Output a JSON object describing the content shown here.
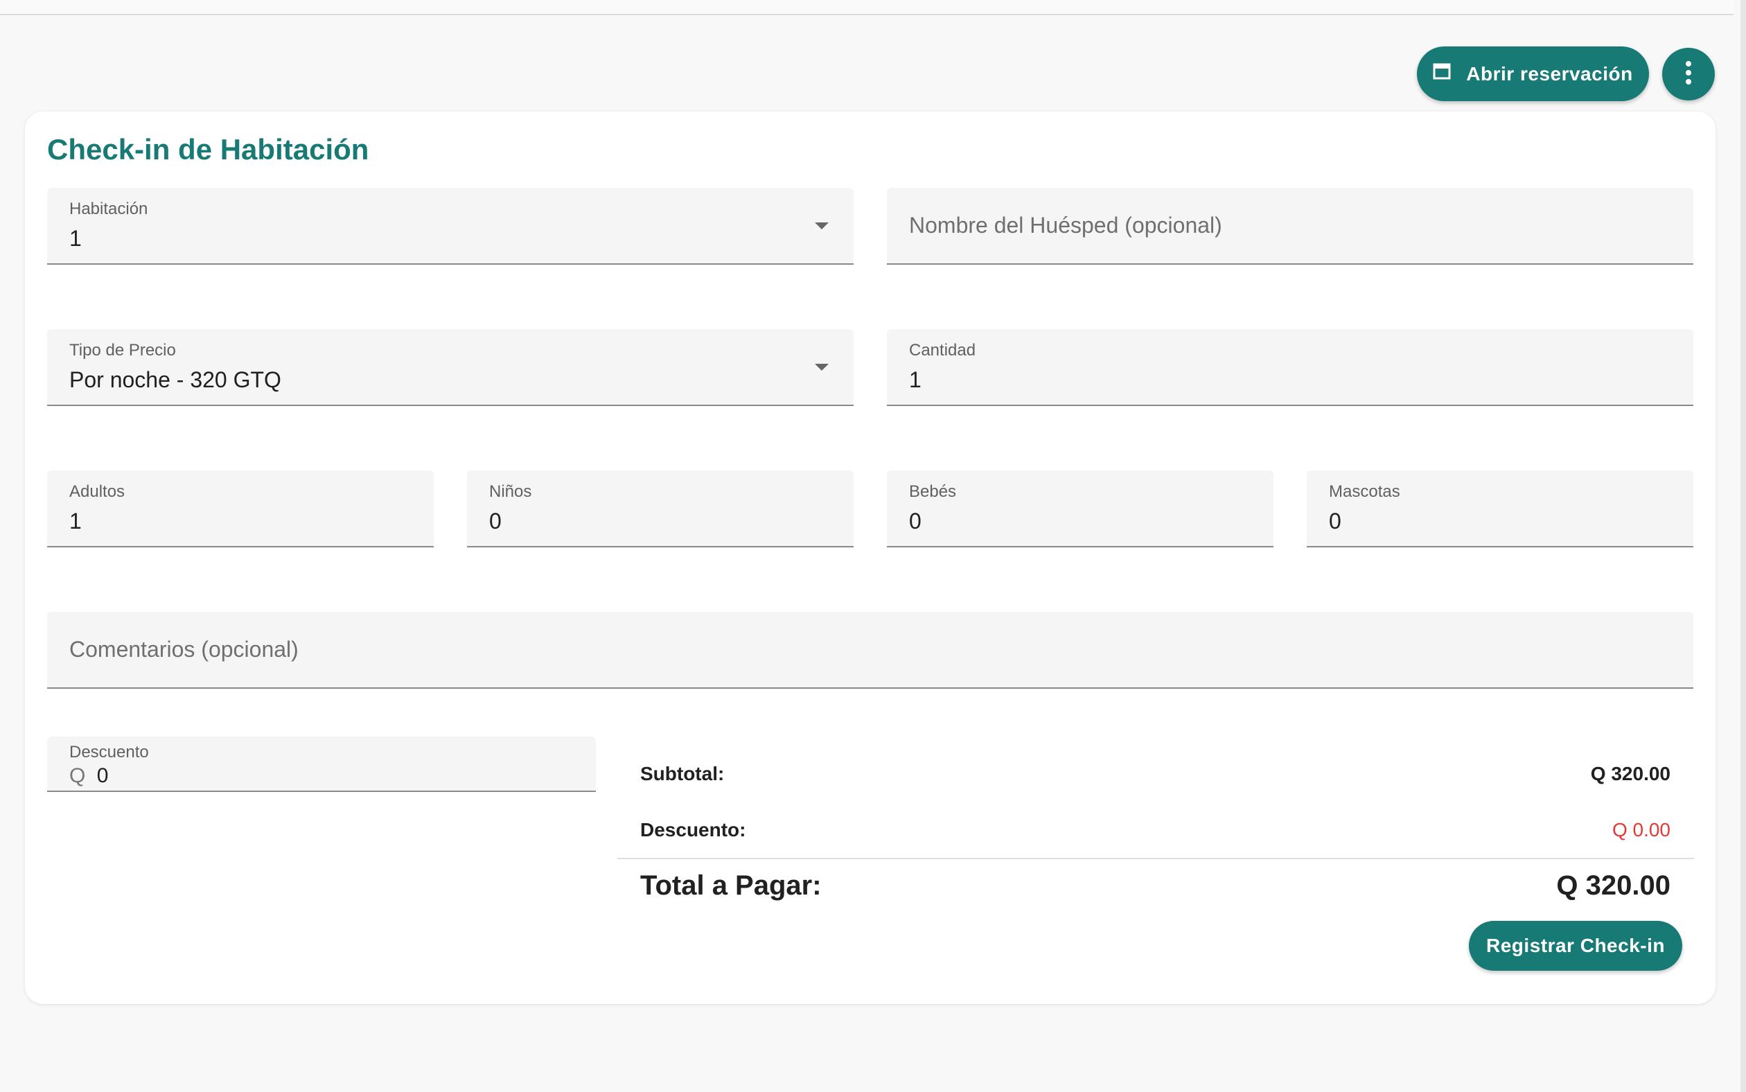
{
  "header": {
    "open_reservation_label": "Abrir reservación",
    "more_icon": "more-vert-icon",
    "calendar_icon": "calendar-icon"
  },
  "card": {
    "title": "Check-in de Habitación"
  },
  "form": {
    "room": {
      "label": "Habitación",
      "value": "1"
    },
    "guest_name": {
      "placeholder": "Nombre del Huésped (opcional)"
    },
    "price_type": {
      "label": "Tipo de Precio",
      "value": "Por noche - 320 GTQ"
    },
    "quantity": {
      "label": "Cantidad",
      "value": "1"
    },
    "adults": {
      "label": "Adultos",
      "value": "1"
    },
    "children": {
      "label": "Niños",
      "value": "0"
    },
    "babies": {
      "label": "Bebés",
      "value": "0"
    },
    "pets": {
      "label": "Mascotas",
      "value": "0"
    },
    "comments": {
      "placeholder": "Comentarios (opcional)"
    },
    "discount": {
      "label": "Descuento",
      "prefix": "Q",
      "value": "0"
    }
  },
  "summary": {
    "subtotal_label": "Subtotal:",
    "subtotal_value": "Q 320.00",
    "discount_label": "Descuento:",
    "discount_value": "Q 0.00",
    "total_label": "Total a Pagar:",
    "total_value": "Q 320.00"
  },
  "actions": {
    "register_label": "Registrar Check-in"
  },
  "colors": {
    "primary": "#177a74",
    "discount_red": "#e53935",
    "field_bg": "#f5f5f5"
  }
}
